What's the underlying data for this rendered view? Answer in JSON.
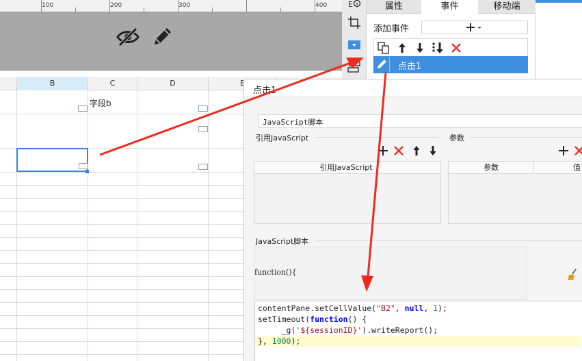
{
  "ruler": {
    "marks": [
      "100",
      "200",
      "300",
      "400"
    ]
  },
  "sheet": {
    "columns": [
      "B",
      "C",
      "D",
      "E"
    ],
    "selected_column": "B",
    "cells": {
      "C2": "字段b"
    }
  },
  "panel": {
    "tabs": [
      "属性",
      "事件",
      "移动端"
    ],
    "active_tab": "事件",
    "add_event_label": "添加事件",
    "add_event_button": "+",
    "event_item_label": "点击1"
  },
  "dialog": {
    "title": "点击1",
    "script_type": "JavaScript脚本",
    "ref_js_section": "引用JavaScript",
    "params_section": "参数",
    "ref_js_column": "引用JavaScript",
    "params_column": "参数",
    "value_column": "值",
    "js_script_section": "JavaScript脚本",
    "function_header": "function(){",
    "code_lines": [
      "contentPane.setCellValue(\"B2\", null, 1);",
      "setTimeout(function() {",
      "     _g('${sessionID}').writeReport();",
      "}, 1000);"
    ]
  },
  "icons": {
    "strip": [
      "eye-hidden-icon",
      "pencil-icon"
    ],
    "toolbar": [
      "info-edit-icon",
      "crop-icon",
      "dropdown-widget-icon",
      "layers-icon"
    ],
    "event_toolbar": [
      "copy-icon",
      "move-up-icon",
      "move-down-icon",
      "move-bottom-icon",
      "delete-icon"
    ],
    "sub_toolbar": [
      "add-icon",
      "delete-icon",
      "move-up-icon",
      "move-down-icon"
    ]
  },
  "colors": {
    "accent": "#3f8fe0",
    "delete": "#e5332a",
    "arrow": "#ee2a1f",
    "highlight": "#fffbd0"
  }
}
